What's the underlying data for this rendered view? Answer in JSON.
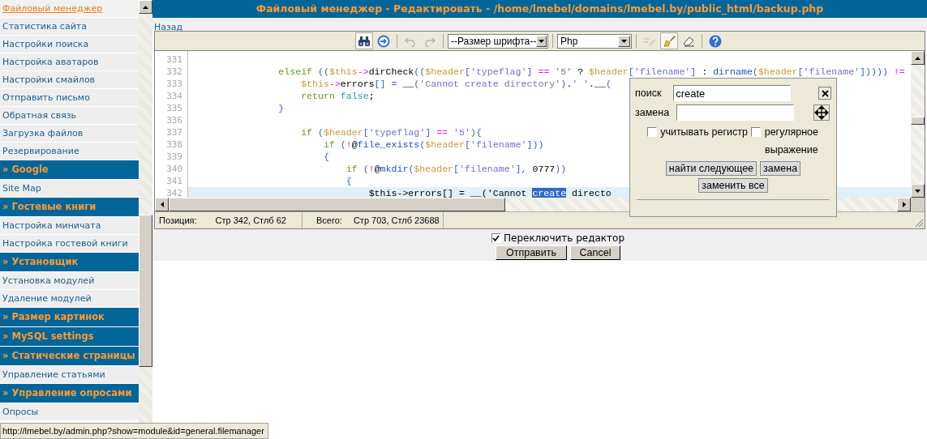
{
  "sidebar": {
    "items": [
      {
        "kind": "link",
        "label": "Файловый менеджер",
        "selected": true
      },
      {
        "kind": "link",
        "label": "Статистика сайта",
        "selected": false
      },
      {
        "kind": "link",
        "label": "Настройки поиска",
        "selected": false
      },
      {
        "kind": "link",
        "label": "Настройка аватаров",
        "selected": false
      },
      {
        "kind": "link",
        "label": "Настройки смайлов",
        "selected": false
      },
      {
        "kind": "link",
        "label": "Отправить письмо",
        "selected": false
      },
      {
        "kind": "link",
        "label": "Обратная связь",
        "selected": false
      },
      {
        "kind": "link",
        "label": "Загрузка файлов",
        "selected": false
      },
      {
        "kind": "link",
        "label": "Резервирование",
        "selected": false
      },
      {
        "kind": "header",
        "label": "» Google"
      },
      {
        "kind": "link",
        "label": "Site Map",
        "selected": false
      },
      {
        "kind": "header",
        "label": "» Гостевые книги"
      },
      {
        "kind": "link",
        "label": "Настройка миничата",
        "selected": false
      },
      {
        "kind": "link",
        "label": "Настройка гостевой книги",
        "selected": false
      },
      {
        "kind": "header",
        "label": "» Установщик"
      },
      {
        "kind": "link",
        "label": "Установка модулей",
        "selected": false
      },
      {
        "kind": "link",
        "label": "Удаление модулей",
        "selected": false
      },
      {
        "kind": "header",
        "label": "» Размер картинок"
      },
      {
        "kind": "header",
        "label": "» MySQL settings"
      },
      {
        "kind": "header",
        "label": "» Статические страницы"
      },
      {
        "kind": "link",
        "label": "Управление статьями",
        "selected": false
      },
      {
        "kind": "header",
        "label": "» Управление опросами"
      },
      {
        "kind": "link",
        "label": "Опросы",
        "selected": false
      }
    ]
  },
  "title": "Файловый менеджер - Редактировать - /home/lmebel/domains/lmebel.by/public_html/backup.php",
  "back_link": "Назад",
  "toolbar": {
    "buttons": [
      {
        "pressed": true,
        "disabled": false
      },
      {
        "pressed": false,
        "disabled": false
      },
      {
        "pressed": false,
        "disabled": true
      },
      {
        "pressed": false,
        "disabled": true
      }
    ],
    "font_size": "--Размер шрифта--",
    "syntax": "Php",
    "tools": [
      {
        "pressed": false,
        "disabled": true
      },
      {
        "pressed": true,
        "disabled": false
      },
      {
        "pressed": false,
        "disabled": false
      },
      {
        "pressed": false,
        "disabled": false
      }
    ]
  },
  "code": [
    {
      "number": "331",
      "current": false
    },
    {
      "number": "332",
      "current": false,
      "segments": [
        {
          "kind": "k",
          "text": "                elseif"
        },
        {
          "kind": "p",
          "text": " (("
        },
        {
          "kind": "v",
          "text": "$this"
        },
        {
          "kind": "o",
          "text": "->"
        },
        {
          "kind": "t",
          "text": "dirCheck"
        },
        {
          "kind": "p",
          "text": "(("
        },
        {
          "kind": "v",
          "text": "$header"
        },
        {
          "kind": "p",
          "text": "["
        },
        {
          "kind": "s",
          "text": "'typeflag'"
        },
        {
          "kind": "p",
          "text": "]"
        },
        {
          "kind": "o",
          "text": " =="
        },
        {
          "kind": "s",
          "text": " '5'"
        },
        {
          "kind": "t",
          "text": " ? "
        },
        {
          "kind": "v",
          "text": "$header"
        },
        {
          "kind": "p",
          "text": "["
        },
        {
          "kind": "s",
          "text": "'filename'"
        },
        {
          "kind": "p",
          "text": "]"
        },
        {
          "kind": "t",
          "text": " : "
        },
        {
          "kind": "b",
          "text": "dirname"
        },
        {
          "kind": "p",
          "text": "("
        },
        {
          "kind": "v",
          "text": "$header"
        },
        {
          "kind": "p",
          "text": "["
        },
        {
          "kind": "s",
          "text": "'filename'"
        },
        {
          "kind": "p",
          "text": "]))))"
        },
        {
          "kind": "o",
          "text": " !="
        }
      ]
    },
    {
      "number": "333",
      "current": false,
      "segments": [
        {
          "kind": "v",
          "text": "                    $this"
        },
        {
          "kind": "o",
          "text": "->"
        },
        {
          "kind": "t",
          "text": "errors"
        },
        {
          "kind": "p",
          "text": "[] = "
        },
        {
          "kind": "t",
          "text": "__"
        },
        {
          "kind": "p",
          "text": "("
        },
        {
          "kind": "s",
          "text": "'Cannot create directory'"
        },
        {
          "kind": "p",
          "text": ")"
        },
        {
          "kind": "t",
          "text": "."
        },
        {
          "kind": "s",
          "text": "' '"
        },
        {
          "kind": "t",
          "text": "."
        },
        {
          "kind": "t",
          "text": "__"
        },
        {
          "kind": "p",
          "text": "("
        }
      ]
    },
    {
      "number": "334",
      "current": false,
      "segments": [
        {
          "kind": "k",
          "text": "                    return"
        },
        {
          "kind": "c",
          "text": " false"
        },
        {
          "kind": "t",
          "text": ";"
        }
      ]
    },
    {
      "number": "335",
      "current": false,
      "segments": [
        {
          "kind": "p",
          "text": "                }"
        }
      ]
    },
    {
      "number": "336",
      "current": false
    },
    {
      "number": "337",
      "current": false,
      "segments": [
        {
          "kind": "k",
          "text": "                    if"
        },
        {
          "kind": "p",
          "text": " ("
        },
        {
          "kind": "v",
          "text": "$header"
        },
        {
          "kind": "p",
          "text": "["
        },
        {
          "kind": "s",
          "text": "'typeflag'"
        },
        {
          "kind": "p",
          "text": "]"
        },
        {
          "kind": "o",
          "text": " =="
        },
        {
          "kind": "s",
          "text": " '5'"
        },
        {
          "kind": "p",
          "text": "){"
        }
      ]
    },
    {
      "number": "338",
      "current": false,
      "segments": [
        {
          "kind": "k",
          "text": "                        if"
        },
        {
          "kind": "p",
          "text": " ("
        },
        {
          "kind": "o",
          "text": "!"
        },
        {
          "kind": "t",
          "text": "@"
        },
        {
          "kind": "b",
          "text": "file_exists"
        },
        {
          "kind": "p",
          "text": "("
        },
        {
          "kind": "v",
          "text": "$header"
        },
        {
          "kind": "p",
          "text": "["
        },
        {
          "kind": "s",
          "text": "'filename'"
        },
        {
          "kind": "p",
          "text": "]))"
        }
      ]
    },
    {
      "number": "339",
      "current": false,
      "segments": [
        {
          "kind": "p",
          "text": "                        {"
        }
      ]
    },
    {
      "number": "340",
      "current": false,
      "segments": [
        {
          "kind": "k",
          "text": "                            if"
        },
        {
          "kind": "p",
          "text": " ("
        },
        {
          "kind": "o",
          "text": "!"
        },
        {
          "kind": "t",
          "text": "@"
        },
        {
          "kind": "b",
          "text": "mkdir"
        },
        {
          "kind": "p",
          "text": "("
        },
        {
          "kind": "v",
          "text": "$header"
        },
        {
          "kind": "p",
          "text": "["
        },
        {
          "kind": "s",
          "text": "'filename'"
        },
        {
          "kind": "p",
          "text": "],"
        },
        {
          "kind": "t",
          "text": " 0777"
        },
        {
          "kind": "p",
          "text": "))"
        }
      ]
    },
    {
      "number": "341",
      "current": false,
      "segments": [
        {
          "kind": "p",
          "text": "                            {"
        }
      ]
    },
    {
      "number": "342",
      "current": true,
      "segments": [
        {
          "kind": "t",
          "text": "                                $this->errors[] = __('Cannot "
        },
        {
          "kind": "sel",
          "text": "create"
        },
        {
          "kind": "t",
          "text": " directo"
        }
      ]
    }
  ],
  "status": {
    "position_label": "Позиция:",
    "position": "Стр 342, Стлб 62",
    "total_label": "Всего:",
    "total": "Стр 703, Стлб 23688"
  },
  "find_dialog": {
    "search_label": "поиск",
    "search_value": "create",
    "replace_label": "замена",
    "options": [
      {
        "label": "учитывать регистр",
        "checked": false
      },
      {
        "label": "регулярное выражение",
        "checked": false
      }
    ],
    "buttons": [
      "найти следующее",
      "замена",
      "заменить все"
    ]
  },
  "toggle_editor": {
    "label": "Переключить редактор",
    "checked": true
  },
  "buttons": [
    "Отправить",
    "Cancel"
  ],
  "browser_status": "http://lmebel.by/admin.php?show=module&id=general.filemanager"
}
